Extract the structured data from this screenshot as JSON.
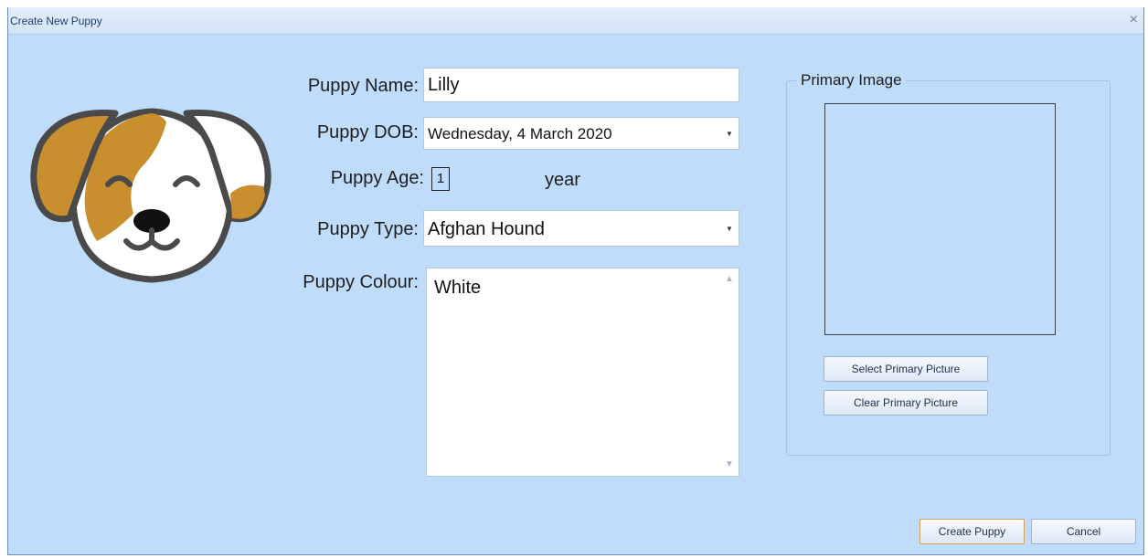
{
  "window": {
    "title": "Create New Puppy",
    "close_glyph": "×"
  },
  "form": {
    "name_label": "Puppy Name:",
    "name_value": "Lilly",
    "dob_label": "Puppy DOB:",
    "dob_value": "Wednesday, 4 March 2020",
    "age_label": "Puppy Age:",
    "age_value": "1",
    "age_unit": "year",
    "type_label": "Puppy Type:",
    "type_value": "Afghan Hound",
    "colour_label": "Puppy Colour:",
    "colour_value": "White"
  },
  "image_group": {
    "title": "Primary Image",
    "select_button": "Select Primary Picture",
    "clear_button": "Clear Primary Picture"
  },
  "footer": {
    "create_button": "Create Puppy",
    "cancel_button": "Cancel"
  },
  "icons": {
    "logo": "puppy-logo-icon",
    "close": "close-icon",
    "dropdown": "chevron-down-icon"
  },
  "colors": {
    "window_bg": "#c0dcfb",
    "ear_color": "#c98f2e",
    "outline": "#4a4a4a"
  }
}
